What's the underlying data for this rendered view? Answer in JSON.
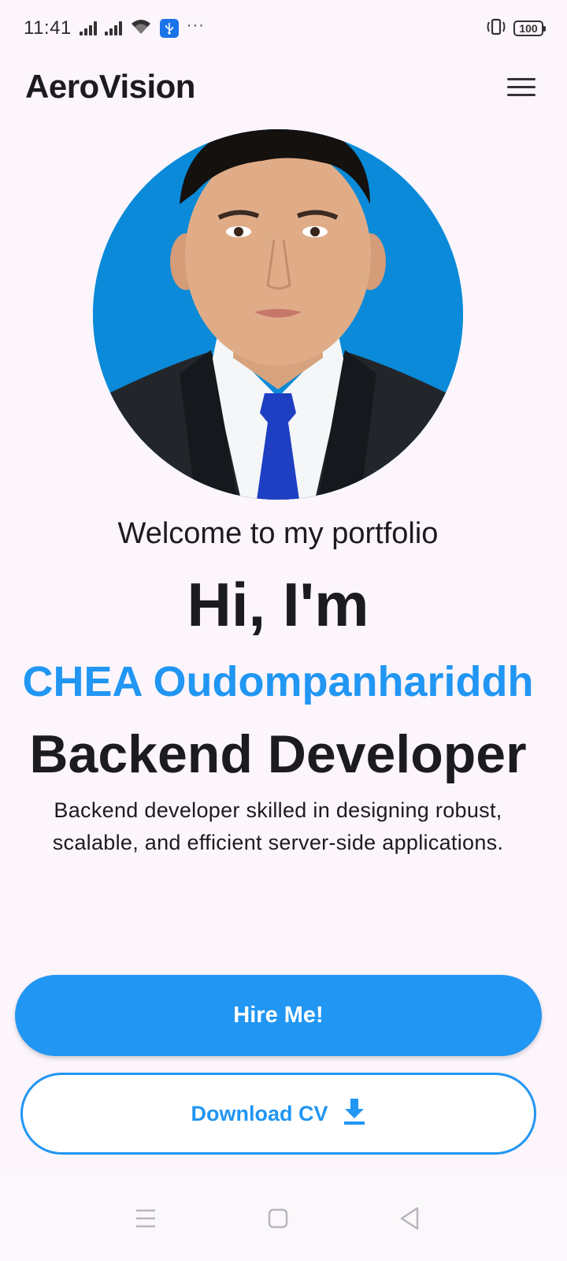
{
  "status_bar": {
    "time": "11:41",
    "battery": "100"
  },
  "app_bar": {
    "title": "AeroVision"
  },
  "hero": {
    "welcome": "Welcome to my portfolio",
    "greeting": "Hi, I'm",
    "name": "CHEA Oudompanhariddh",
    "role": "Backend Developer",
    "description": "Backend developer skilled in designing robust, scalable, and efficient server-side applications."
  },
  "buttons": {
    "hire": "Hire Me!",
    "download_cv": "Download CV"
  },
  "colors": {
    "accent": "#2196f3",
    "background": "#fcf5fc",
    "photo_background": "#0a8ad8"
  },
  "icons": {
    "menu": "hamburger-menu-icon",
    "download": "download-icon"
  }
}
